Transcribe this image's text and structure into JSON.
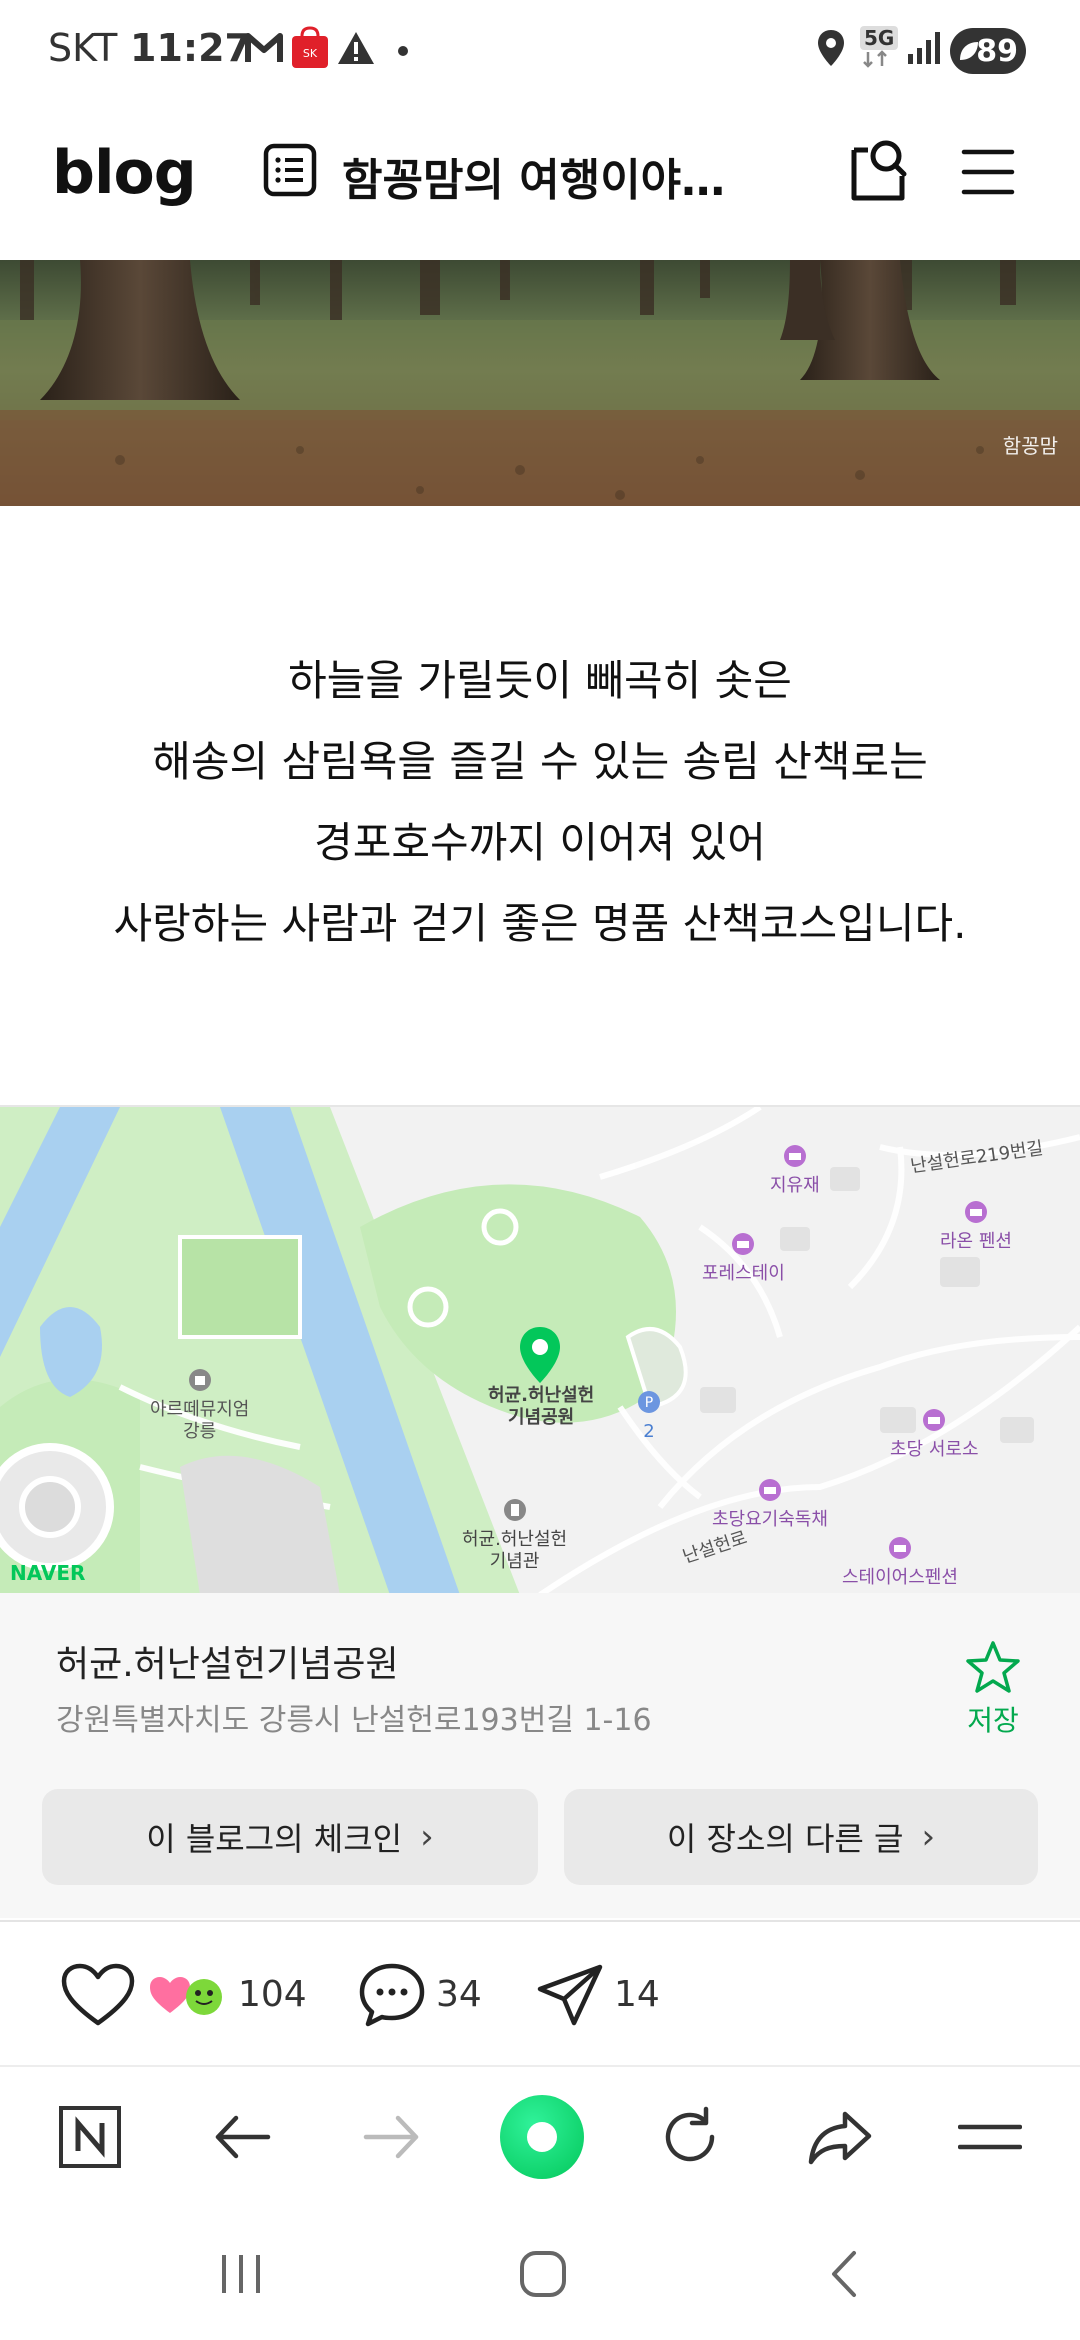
{
  "status_bar": {
    "carrier": "SKT",
    "time": "11:27",
    "network": "5G",
    "battery": "89",
    "icons": [
      "gmail-icon",
      "sk-stoa-icon",
      "alert-icon",
      "location-icon",
      "signal-icon"
    ]
  },
  "header": {
    "logo": "blog",
    "blog_title": "함꽁맘의 여행이야…",
    "icons": [
      "list-icon",
      "search-icon",
      "menu-icon"
    ]
  },
  "banner": {
    "watermark": "함꽁맘"
  },
  "post": {
    "lines": [
      "하늘을 가릴듯이 빼곡히 솟은",
      "해송의 삼림욕을 즐길 수 있는 송림 산책로는",
      "경포호수까지 이어져 있어",
      "사랑하는 사람과 걷기 좋은 명품 산책코스입니다."
    ]
  },
  "map": {
    "labels": {
      "jiyujae": "지유재",
      "nanseolheonro_219": "난설헌로219번길",
      "raon": "라온 펜션",
      "forest_stay": "포레스테이",
      "museum_line1": "아르떼뮤지엄",
      "museum_line2": "강릉",
      "park_line1": "허균.허난설헌",
      "park_line2": "기념공원",
      "parking": "2",
      "chodang_seoroso": "초당 서로소",
      "chodang_dorm": "초당요기숙독채",
      "memorial_line1": "허균.허난설헌",
      "memorial_line2": "기념관",
      "nanseolheonro": "난설헌로",
      "stayus": "스테이어스펜션",
      "provider": "NAVER"
    }
  },
  "place": {
    "name": "허균.허난설헌기념공원",
    "address": "강원특별자치도 강릉시 난설헌로193번길 1-16",
    "save_label": "저장",
    "checkin_button": "이 블로그의 체크인",
    "other_posts_button": "이 장소의 다른 글"
  },
  "reactions": {
    "likes": "104",
    "comments": "34",
    "shares": "14"
  },
  "colors": {
    "naver_green": "#03c75a",
    "save_green": "#03a94e",
    "map_water": "#a9d0f0",
    "map_park": "#cfeec4"
  }
}
